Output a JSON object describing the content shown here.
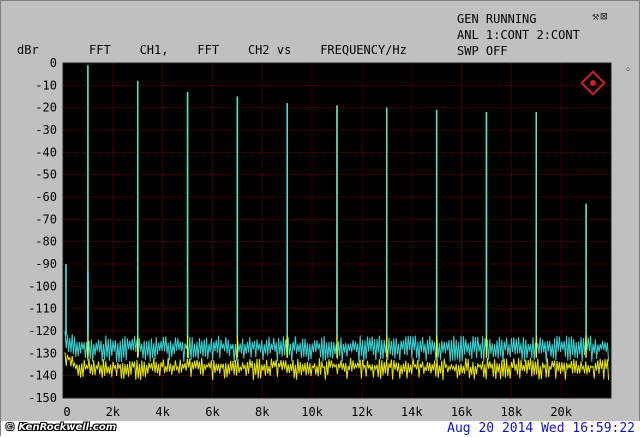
{
  "header": {
    "ylabel": "dBr",
    "title": "FFT    CH1,    FFT    CH2 vs    FREQUENCY/Hz",
    "status_lines": [
      "GEN RUNNING",
      "ANL 1:CONT 2:CONT",
      "SWP OFF"
    ],
    "corner_icon": "settings-tools-icon"
  },
  "footer": {
    "watermark": "© KenRockwell.com",
    "timestamp": "Aug 20 2014 Wed 16:59:22"
  },
  "colors": {
    "background": "#c0c0c0",
    "plot_bg": "#000000",
    "grid": "#7a0000",
    "ch1": "#ffff00",
    "ch2": "#40e8e8"
  },
  "chart_data": {
    "type": "line",
    "title": "FFT CH1, FFT CH2 vs FREQUENCY/Hz",
    "xlabel": "",
    "ylabel": "dBr",
    "xlim": [
      0,
      22000
    ],
    "ylim": [
      -150,
      0
    ],
    "x_ticks": [
      "0",
      "2k",
      "4k",
      "6k",
      "8k",
      "10k",
      "12k",
      "14k",
      "16k",
      "18k",
      "20k"
    ],
    "y_ticks": [
      "0",
      "-10",
      "-20",
      "-30",
      "-40",
      "-50",
      "-60",
      "-70",
      "-80",
      "-90",
      "-100",
      "-110",
      "-120",
      "-130",
      "-140",
      "-150"
    ],
    "grid": true,
    "series": [
      {
        "color": "yellow",
        "noise_floor_db": [
          -132,
          -142
        ],
        "peaks": [
          {
            "x": 1000,
            "y": -1
          },
          {
            "x": 3000,
            "y": -8
          },
          {
            "x": 5000,
            "y": -13
          },
          {
            "x": 7000,
            "y": -15
          },
          {
            "x": 9000,
            "y": -18
          },
          {
            "x": 11000,
            "y": -19
          },
          {
            "x": 13000,
            "y": -20
          },
          {
            "x": 15000,
            "y": -21
          },
          {
            "x": 17000,
            "y": -22
          },
          {
            "x": 19000,
            "y": -22
          },
          {
            "x": 21000,
            "y": -63
          }
        ]
      },
      {
        "color": "cyan",
        "noise_floor_db": [
          -122,
          -134
        ],
        "peaks": [
          {
            "x": 1000,
            "y": -1
          },
          {
            "x": 3000,
            "y": -8
          },
          {
            "x": 5000,
            "y": -13
          },
          {
            "x": 7000,
            "y": -15
          },
          {
            "x": 9000,
            "y": -18
          },
          {
            "x": 11000,
            "y": -19
          },
          {
            "x": 13000,
            "y": -20
          },
          {
            "x": 15000,
            "y": -21
          },
          {
            "x": 17000,
            "y": -22
          },
          {
            "x": 19000,
            "y": -22
          },
          {
            "x": 21000,
            "y": -63
          }
        ],
        "low_freq_spur": [
          {
            "x": 0,
            "y": -90
          },
          {
            "x": 1000,
            "y": -94
          }
        ]
      }
    ]
  }
}
